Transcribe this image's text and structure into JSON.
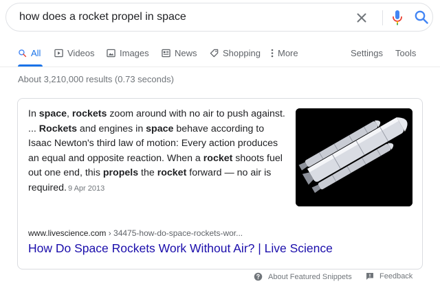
{
  "search": {
    "query": "how does a rocket propel in space",
    "clear_icon": "close-icon",
    "mic_icon": "microphone-icon",
    "search_icon": "search-icon"
  },
  "tabs": [
    {
      "label": "All",
      "icon": "search-icon",
      "active": true
    },
    {
      "label": "Videos",
      "icon": "video-icon"
    },
    {
      "label": "Images",
      "icon": "image-icon"
    },
    {
      "label": "News",
      "icon": "news-icon"
    },
    {
      "label": "Shopping",
      "icon": "tag-icon"
    },
    {
      "label": "More",
      "icon": "more-vert-icon"
    }
  ],
  "tools": {
    "settings": "Settings",
    "tools": "Tools"
  },
  "results_stats": "About 3,210,000 results (0.73 seconds)",
  "featured": {
    "parts": [
      {
        "t": "In ",
        "b": false
      },
      {
        "t": "space",
        "b": true
      },
      {
        "t": ", ",
        "b": false
      },
      {
        "t": "rockets",
        "b": true
      },
      {
        "t": " zoom around with no air to push against. ... ",
        "b": false
      },
      {
        "t": "Rockets",
        "b": true
      },
      {
        "t": " and engines in ",
        "b": false
      },
      {
        "t": "space",
        "b": true
      },
      {
        "t": " behave according to Isaac Newton's third law of motion: Every action produces an equal and opposite reaction. When a ",
        "b": false
      },
      {
        "t": "rocket",
        "b": true
      },
      {
        "t": " shoots fuel out one end, this ",
        "b": false
      },
      {
        "t": "propels",
        "b": true
      },
      {
        "t": " the ",
        "b": false
      },
      {
        "t": "rocket",
        "b": true
      },
      {
        "t": " forward — no air is required.",
        "b": false
      }
    ],
    "date": "9 Apr 2013",
    "source_domain": "www.livescience.com",
    "source_path": " › 34475-how-do-space-rockets-wor...",
    "title": "How Do Space Rockets Work Without Air? | Live Science",
    "accent": "#1a0dab"
  },
  "footer": {
    "about": "About Featured Snippets",
    "feedback": "Feedback"
  },
  "colors": {
    "active_tab": "#1a73e8",
    "link": "#1a0dab",
    "muted": "#70757a"
  }
}
